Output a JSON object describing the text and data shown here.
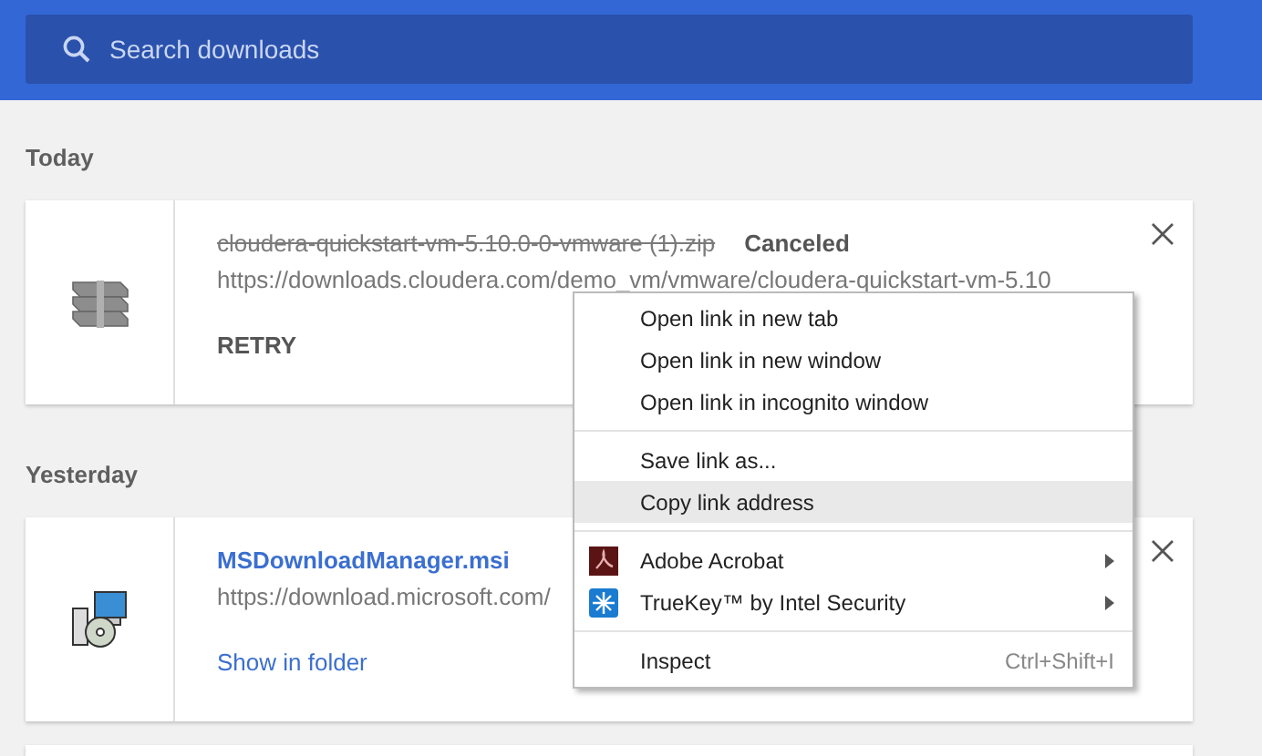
{
  "search": {
    "placeholder": "Search downloads"
  },
  "sections": [
    {
      "heading": "Today",
      "items": [
        {
          "kind": "archive",
          "name": "cloudera-quickstart-vm-5.10.0-0-vmware (1).zip",
          "status": "Canceled",
          "url": "https://downloads.cloudera.com/demo_vm/vmware/cloudera-quickstart-vm-5.10",
          "action": "RETRY",
          "canceled": true
        }
      ]
    },
    {
      "heading": "Yesterday",
      "items": [
        {
          "kind": "installer",
          "name": "MSDownloadManager.msi",
          "url": "https://download.microsoft.com/",
          "action": "Show in folder",
          "canceled": false
        }
      ]
    }
  ],
  "context_menu": {
    "groups": [
      [
        {
          "kind": "plain",
          "label": "Open link in new tab",
          "selected": false
        },
        {
          "kind": "plain",
          "label": "Open link in new window",
          "selected": false
        },
        {
          "kind": "plain",
          "label": "Open link in incognito window",
          "selected": false
        }
      ],
      [
        {
          "kind": "plain",
          "label": "Save link as...",
          "selected": false
        },
        {
          "kind": "plain",
          "label": "Copy link address",
          "selected": true
        }
      ],
      [
        {
          "kind": "acrobat",
          "label": "Adobe Acrobat",
          "submenu": true,
          "selected": false
        },
        {
          "kind": "truekey",
          "label": "TrueKey™ by Intel Security",
          "submenu": true,
          "selected": false
        }
      ],
      [
        {
          "kind": "plain",
          "label": "Inspect",
          "shortcut": "Ctrl+Shift+I",
          "selected": false
        }
      ]
    ]
  }
}
